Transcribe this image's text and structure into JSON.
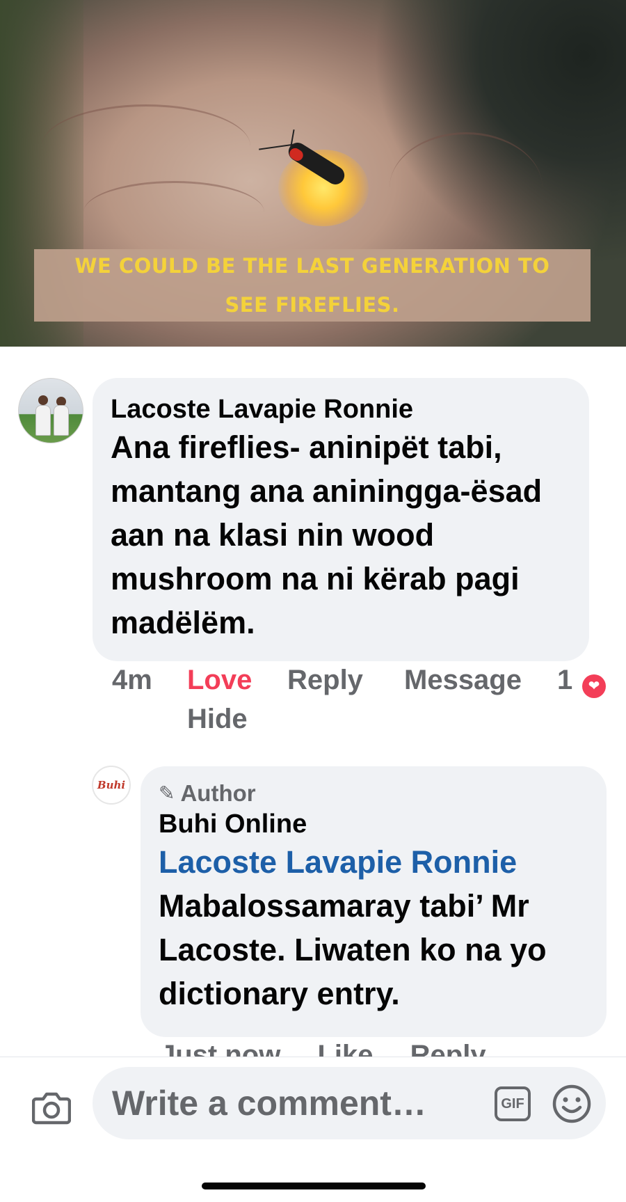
{
  "hero": {
    "banner_text": "WE COULD BE THE LAST GENERATION TO SEE FIREFLIES."
  },
  "comment": {
    "author": "Lacoste Lavapie Ronnie",
    "text": "Ana fireflies- aninipët tabi, mantang ana aniningga-ësad aan na klasi nin wood mushroom na ni kërab pagi madëlëm.",
    "time": "4m",
    "love_label": "Love",
    "reply_label": "Reply",
    "message_label": "Message",
    "hide_label": "Hide",
    "reaction_count": "1",
    "reaction_icon": "heart-icon"
  },
  "reply": {
    "badge": "Author",
    "author": "Buhi Online",
    "avatar_text": "Buhi",
    "mention": "Lacoste Lavapie Ronnie",
    "text": " Mabalossamaray tabi’ Mr Lacoste.  Liwaten ko na yo dictionary entry.",
    "partial_actions": [
      "Just now",
      "Like",
      "Reply"
    ]
  },
  "composer": {
    "placeholder": "Write a comment…",
    "gif_label": "GIF",
    "camera_icon": "camera-icon",
    "emoji_icon": "smiley-icon"
  }
}
